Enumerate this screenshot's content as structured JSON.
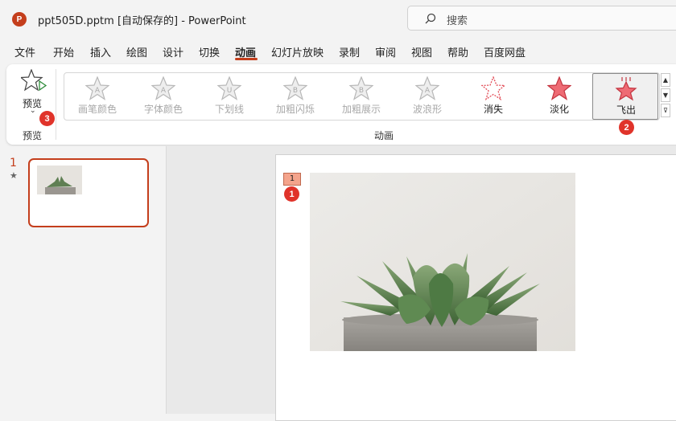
{
  "window": {
    "title": "ppt505D.pptm [自动保存的]  -  PowerPoint",
    "app_icon_letter": "P",
    "search_placeholder": "搜索"
  },
  "menu": {
    "tabs": [
      "文件",
      "开始",
      "插入",
      "绘图",
      "设计",
      "切换",
      "动画",
      "幻灯片放映",
      "录制",
      "审阅",
      "视图",
      "帮助",
      "百度网盘"
    ],
    "active_tab": "动画"
  },
  "ribbon": {
    "preview": {
      "button_label": "预览",
      "dropdown_glyph": "⌄",
      "group_label": "预览"
    },
    "animation_group_label": "动画",
    "effects": [
      {
        "label": "画笔颜色",
        "letter": "A",
        "enabled": false
      },
      {
        "label": "字体颜色",
        "letter": "A",
        "enabled": false
      },
      {
        "label": "下划线",
        "letter": "U",
        "enabled": false
      },
      {
        "label": "加粗闪烁",
        "letter": "B",
        "enabled": false
      },
      {
        "label": "加粗展示",
        "letter": "B",
        "enabled": false
      },
      {
        "label": "波浪形",
        "letter": "A",
        "enabled": false
      },
      {
        "label": "消失",
        "letter": "",
        "enabled": true
      },
      {
        "label": "淡化",
        "letter": "",
        "enabled": true
      },
      {
        "label": "飞出",
        "letter": "",
        "enabled": true,
        "selected": true
      }
    ],
    "scroll_glyphs": [
      "▲",
      "▼",
      "⊽"
    ]
  },
  "markers": [
    "1",
    "2",
    "3"
  ],
  "slides_pane": {
    "slide_number": "1",
    "anim_indicator": "★"
  },
  "slide": {
    "anim_tag": "1"
  },
  "colors": {
    "accent": "#c43e1c",
    "marker": "#e0332a",
    "star_enabled": "#e24a55",
    "star_disabled": "#b8b8b8"
  }
}
